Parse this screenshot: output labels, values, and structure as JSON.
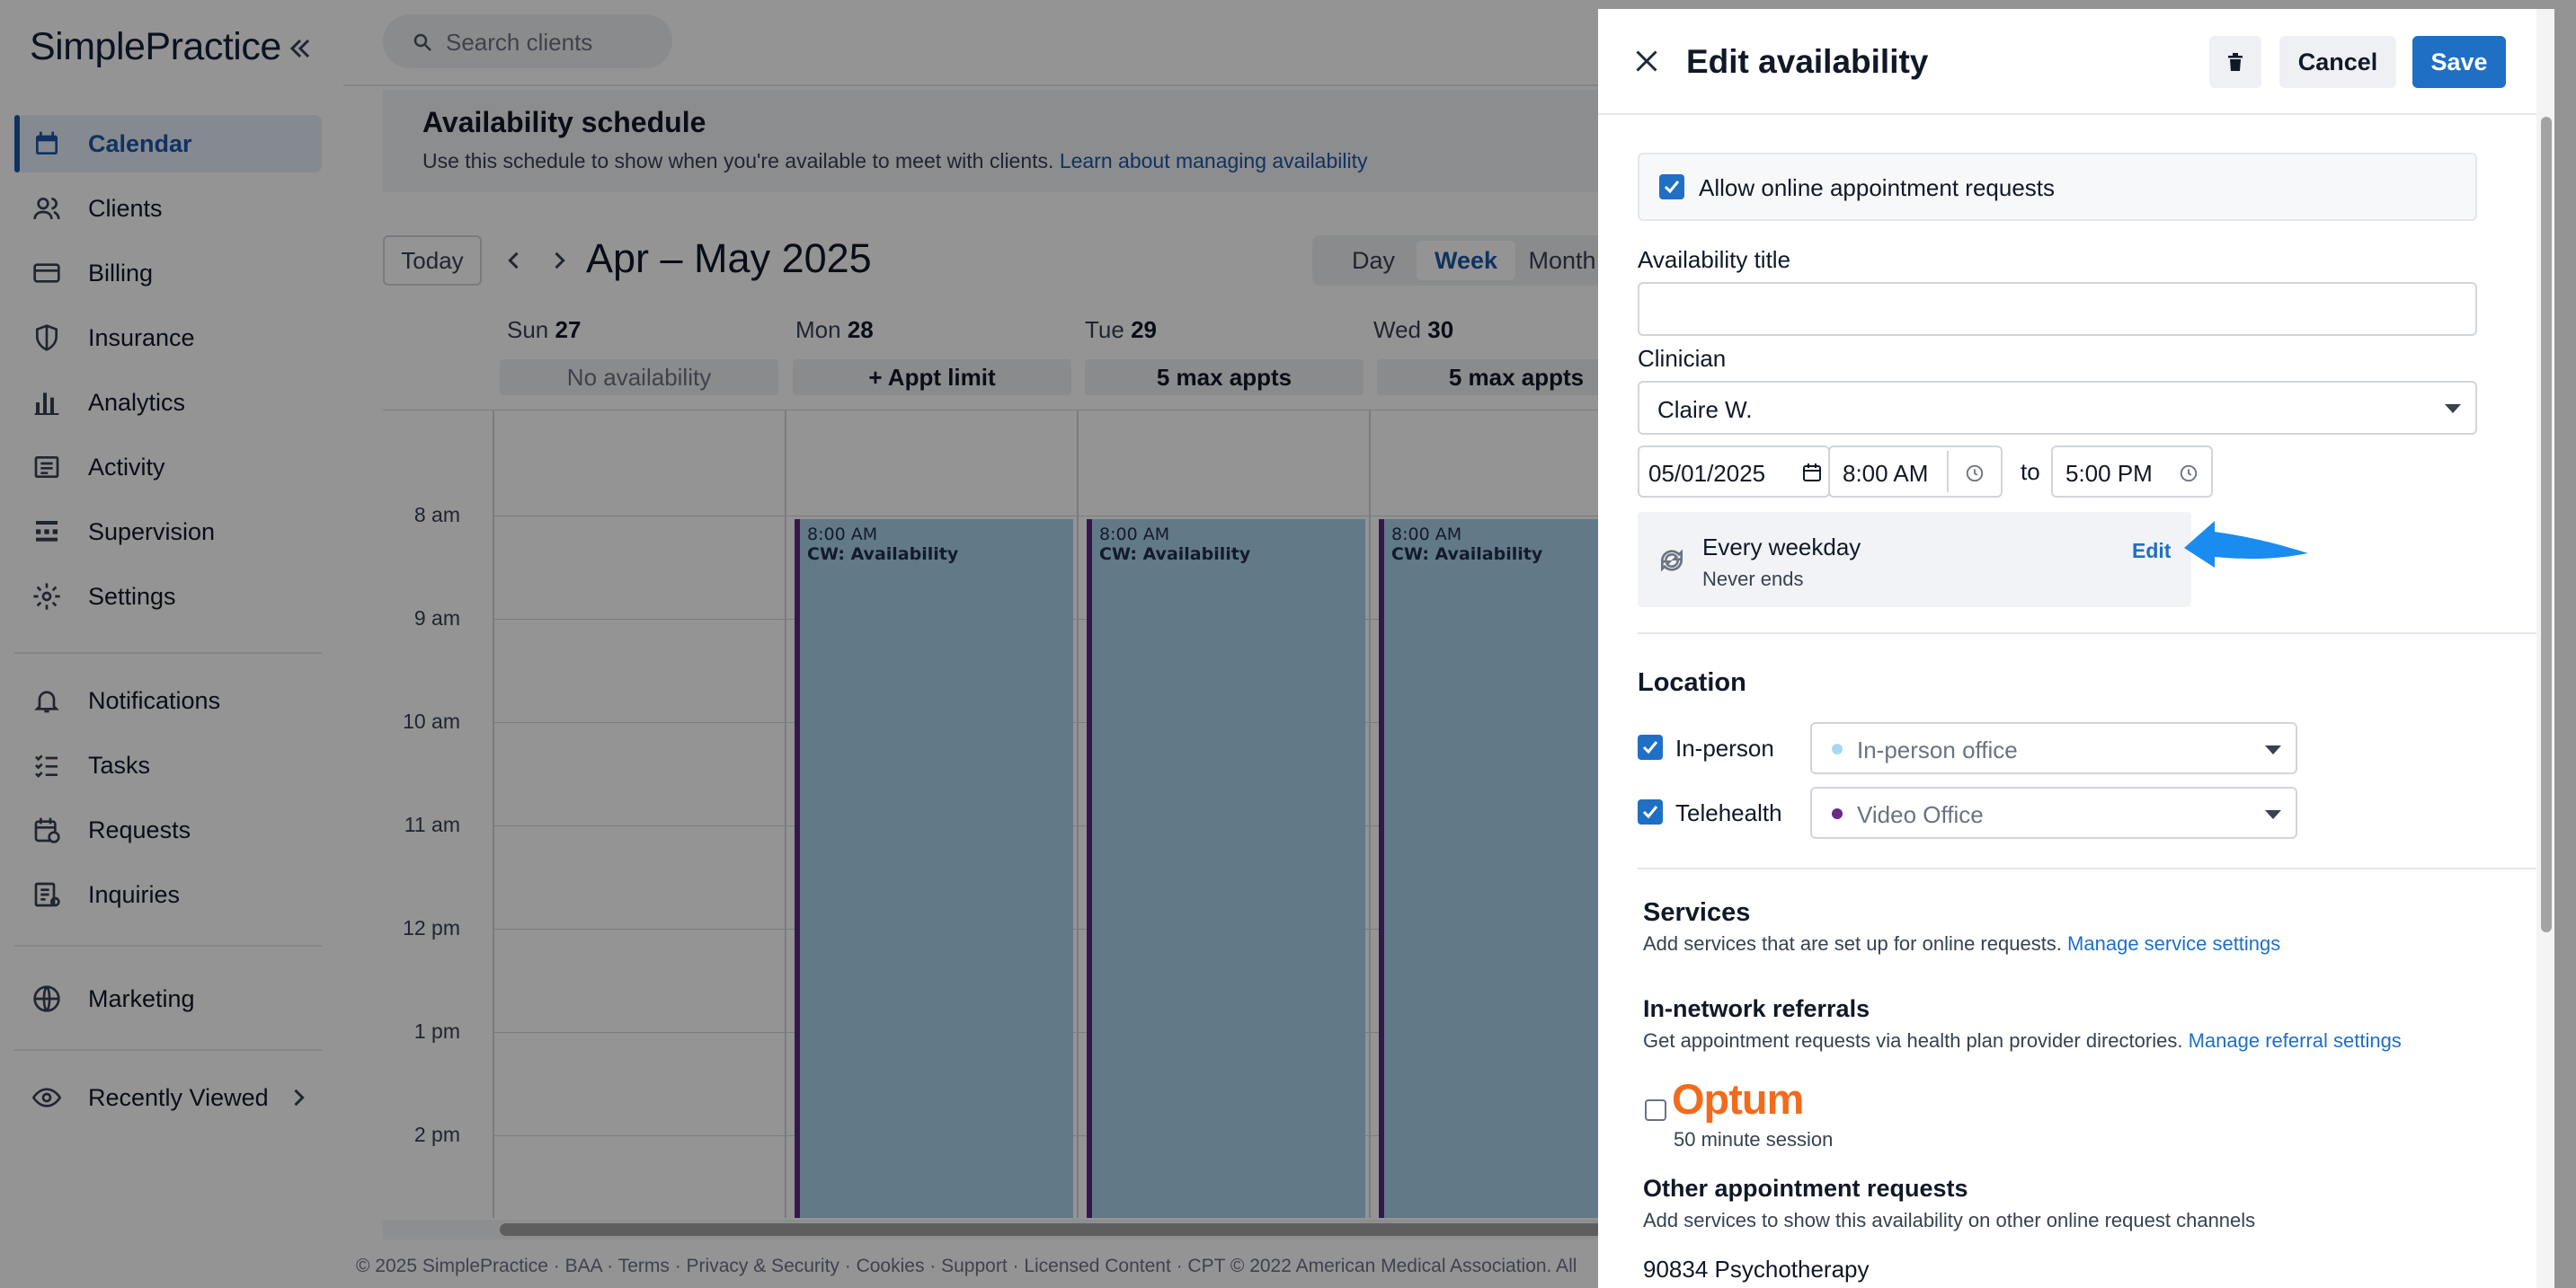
{
  "sidebar": {
    "logo": "SimplePractice",
    "items": [
      {
        "label": "Calendar",
        "icon": "calendar-icon",
        "active": true
      },
      {
        "label": "Clients",
        "icon": "clients-icon"
      },
      {
        "label": "Billing",
        "icon": "credit-card-icon"
      },
      {
        "label": "Insurance",
        "icon": "shield-icon"
      },
      {
        "label": "Analytics",
        "icon": "bar-chart-icon"
      },
      {
        "label": "Activity",
        "icon": "list-icon"
      },
      {
        "label": "Supervision",
        "icon": "supervision-icon"
      },
      {
        "label": "Settings",
        "icon": "gear-icon"
      },
      {
        "label": "Notifications",
        "icon": "bell-icon"
      },
      {
        "label": "Tasks",
        "icon": "tasks-icon"
      },
      {
        "label": "Requests",
        "icon": "requests-icon"
      },
      {
        "label": "Inquiries",
        "icon": "inquiries-icon"
      },
      {
        "label": "Marketing",
        "icon": "globe-icon"
      },
      {
        "label": "Recently Viewed",
        "icon": "eye-icon"
      }
    ]
  },
  "search": {
    "placeholder": "Search clients"
  },
  "banner": {
    "title": "Availability schedule",
    "text": "Use this schedule to show when you're available to meet with clients.",
    "link": "Learn about managing availability"
  },
  "calendar": {
    "today_label": "Today",
    "range": "Apr – May 2025",
    "views": [
      "Day",
      "Week",
      "Month"
    ],
    "active_view": "Week",
    "days": [
      {
        "dow": "Sun",
        "num": "27",
        "badge": "No availability"
      },
      {
        "dow": "Mon",
        "num": "28",
        "badge": "+ Appt limit"
      },
      {
        "dow": "Tue",
        "num": "29",
        "badge": "5 max appts"
      },
      {
        "dow": "Wed",
        "num": "30",
        "badge": "5 max appts"
      }
    ],
    "times": [
      "8 am",
      "9 am",
      "10 am",
      "11 am",
      "12 pm",
      "1 pm",
      "2 pm"
    ],
    "event": {
      "time": "8:00 AM",
      "name": "CW: Availability"
    }
  },
  "footer": "© 2025 SimplePractice · BAA · Terms · Privacy & Security · Cookies · Support · Licensed Content · CPT © 2022 American Medical Association. All",
  "panel": {
    "title": "Edit availability",
    "cancel": "Cancel",
    "save": "Save",
    "allow_requests": "Allow online appointment requests",
    "availability_title_label": "Availability title",
    "availability_title_value": "",
    "clinician_label": "Clinician",
    "clinician_value": "Claire W.",
    "date": "05/01/2025",
    "start_time": "8:00 AM",
    "to": "to",
    "end_time": "5:00 PM",
    "recurrence": "Every weekday",
    "recurrence_end": "Never ends",
    "recurrence_edit": "Edit",
    "location_title": "Location",
    "locations": [
      {
        "label": "In-person",
        "value": "In-person office",
        "dot": "#a8d8f0"
      },
      {
        "label": "Telehealth",
        "value": "Video Office",
        "dot": "#6b2a8a"
      }
    ],
    "services_title": "Services",
    "services_desc": "Add services that are set up for online requests.",
    "services_link": "Manage service settings",
    "referrals_title": "In-network referrals",
    "referrals_desc": "Get appointment requests via health plan provider directories.",
    "referrals_link": "Manage referral settings",
    "optum_logo": "Optum",
    "optum_session": "50 minute session",
    "other_title": "Other appointment requests",
    "other_desc": "Add services to show this availability on other online request channels",
    "other_item": "90834 Psychotherapy"
  },
  "colors": {
    "accent": "#1f6fc5",
    "availability": "#a9d1eb",
    "stripe": "#5b2a86",
    "optum": "#f26b1d"
  }
}
